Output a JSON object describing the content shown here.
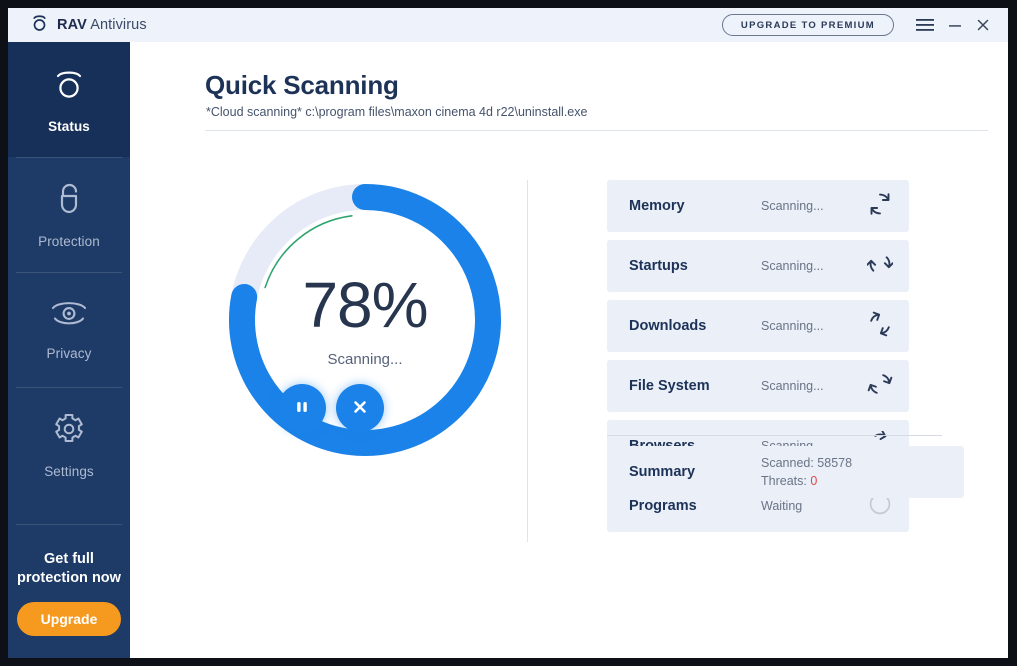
{
  "titlebar": {
    "logo_icon": "rav-o-logo-icon",
    "brand_bold": "RAV",
    "brand_light": "Antivirus",
    "upgrade_label": "UPGRADE TO PREMIUM",
    "menu_icon": "hamburger-menu-icon",
    "minimize_icon": "minimize-icon",
    "close_icon": "close-icon"
  },
  "sidebar": {
    "items": [
      {
        "label": "Status",
        "icon": "shield-o-status-icon",
        "active": true
      },
      {
        "label": "Protection",
        "icon": "lock-open-icon",
        "active": false
      },
      {
        "label": "Privacy",
        "icon": "eye-icon",
        "active": false
      },
      {
        "label": "Settings",
        "icon": "gear-icon",
        "active": false
      }
    ],
    "promo_text": "Get full\nprotection now",
    "promo_line1": "Get full",
    "promo_line2": "protection now",
    "upgrade_button": "Upgrade",
    "upgrade_color": "#f59a1e"
  },
  "main": {
    "title": "Quick Scanning",
    "subtitle": "*Cloud scanning* c:\\program files\\maxon cinema 4d r22\\uninstall.exe"
  },
  "progress": {
    "percent_label": "78%",
    "percent_value": 78,
    "status": "Scanning...",
    "arc_color": "#1a82e8",
    "track_color": "#e6ebf7",
    "inner_arc_color": "#2fa36e",
    "inner_arc_percent": 18
  },
  "controls": [
    {
      "name": "pause-scan-button",
      "icon": "pause-icon"
    },
    {
      "name": "stop-scan-button",
      "icon": "close-x-icon"
    }
  ],
  "scan_items": [
    {
      "name": "Memory",
      "status": "Scanning...",
      "icon": "refresh-spin-icon",
      "state": "scanning",
      "rotation": 0
    },
    {
      "name": "Startups",
      "status": "Scanning...",
      "icon": "refresh-spin-icon",
      "state": "scanning",
      "rotation": 45
    },
    {
      "name": "Downloads",
      "status": "Scanning...",
      "icon": "refresh-spin-icon",
      "state": "scanning",
      "rotation": 110
    },
    {
      "name": "File System",
      "status": "Scanning...",
      "icon": "refresh-spin-icon",
      "state": "scanning",
      "rotation": 200
    },
    {
      "name": "Browsers",
      "status": "Scanning...",
      "icon": "refresh-spin-icon",
      "state": "scanning",
      "rotation": 330
    },
    {
      "name": "Programs",
      "status": "Waiting",
      "icon": "empty-circle-icon",
      "state": "waiting",
      "rotation": 0
    }
  ],
  "summary": {
    "label": "Summary",
    "scanned_line": "Scanned: 58578",
    "threats_prefix": "Threats: ",
    "threats_count": "0",
    "threats_color": "#e14747"
  }
}
